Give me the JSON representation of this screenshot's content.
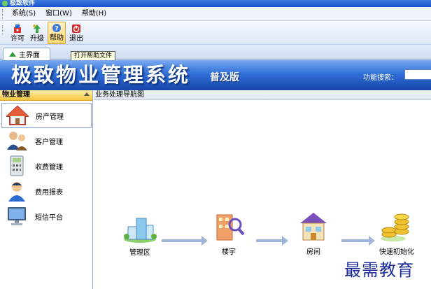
{
  "window": {
    "title": "极致软件"
  },
  "menu": [
    {
      "label": "系统(S)"
    },
    {
      "label": "窗口(W)"
    },
    {
      "label": "帮助(H)"
    }
  ],
  "toolbar": [
    {
      "label": "许可",
      "icon": "license-icon"
    },
    {
      "label": "升级",
      "icon": "upgrade-icon"
    },
    {
      "label": "帮助",
      "icon": "help-icon"
    },
    {
      "label": "退出",
      "icon": "exit-icon"
    }
  ],
  "tab": {
    "label": "主界面"
  },
  "tooltip": {
    "text": "打开帮助文件"
  },
  "banner": {
    "title": "极致物业管理系统",
    "edition": "普及版",
    "search_label": "功能搜索："
  },
  "sidebar": {
    "header": "物业管理",
    "items": [
      {
        "label": "房产管理",
        "icon": "house-icon"
      },
      {
        "label": "客户管理",
        "icon": "customers-icon"
      },
      {
        "label": "收费管理",
        "icon": "calculator-icon"
      },
      {
        "label": "费用报表",
        "icon": "user-report-icon"
      },
      {
        "label": "短信平台",
        "icon": "monitor-icon"
      }
    ]
  },
  "main": {
    "header": "业务处理导航图",
    "flow": [
      {
        "label": "管理区",
        "icon": "district-buildings-icon"
      },
      {
        "label": "楼宇",
        "icon": "building-magnifier-icon"
      },
      {
        "label": "房间",
        "icon": "room-house-icon"
      },
      {
        "label": "快速初始化",
        "icon": "coins-icon"
      }
    ]
  },
  "watermark": "最需教育",
  "colors": {
    "banner_blue": "#2f6fd8",
    "panel_header_yellow": "#f5c741",
    "watermark_blue": "#1a2a9a"
  }
}
